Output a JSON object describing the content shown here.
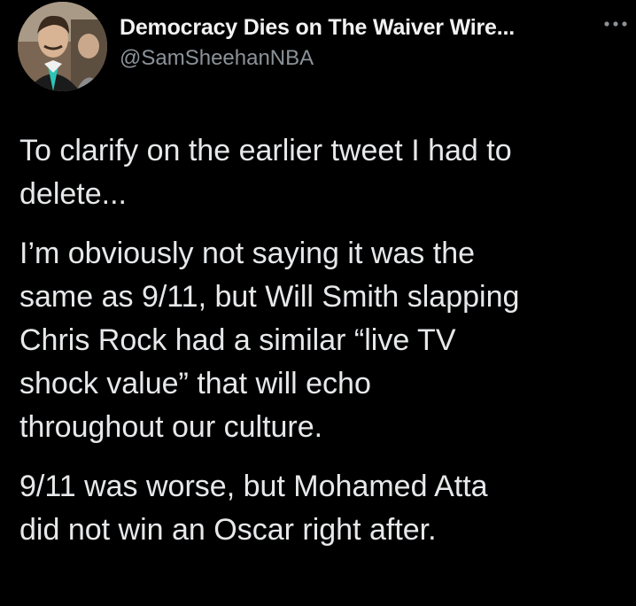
{
  "tweet": {
    "author": {
      "display_name": "Democracy Dies on The Waiver Wire...",
      "handle": "@SamSheehanNBA",
      "avatar_icon": "avatar-photo"
    },
    "more_icon": "more-horizontal-icon",
    "paragraphs": [
      "To clarify on the earlier tweet I had to\ndelete...",
      "I’m obviously not saying it was the\nsame as 9/11, but Will Smith slapping\nChris Rock had a similar “live TV\nshock value” that will echo\nthroughout our culture.",
      "9/11 was worse, but Mohamed Atta\ndid not win an Oscar right after."
    ]
  },
  "colors": {
    "background": "#000000",
    "text": "#e7e9ea",
    "secondary_text": "#8b9299"
  }
}
